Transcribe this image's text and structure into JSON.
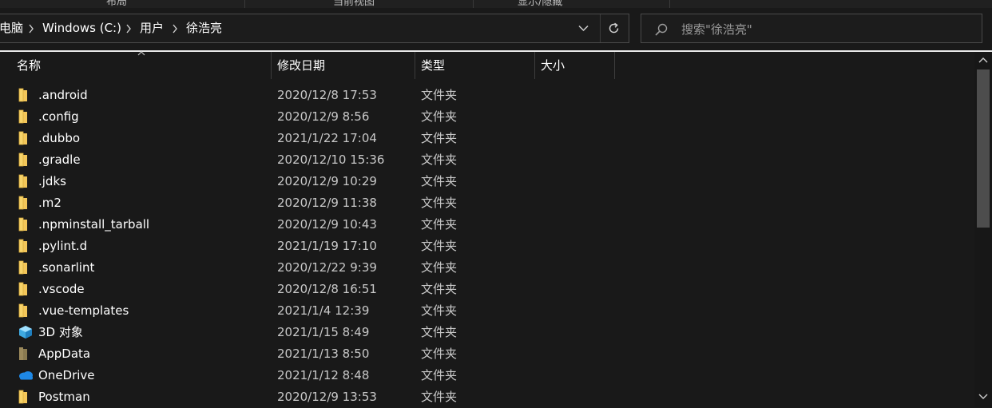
{
  "ribbon": {
    "groups": [
      "布局",
      "当前视图",
      "显示/隐藏"
    ]
  },
  "address": {
    "breadcrumbs": [
      "电脑",
      "Windows (C:)",
      "用户",
      "徐浩亮"
    ]
  },
  "search": {
    "placeholder": "搜索\"徐浩亮\""
  },
  "columns": {
    "name": "名称",
    "modified": "修改日期",
    "type": "类型",
    "size": "大小"
  },
  "files": [
    {
      "name": ".android",
      "modified": "2020/12/8 17:53",
      "type": "文件夹",
      "icon": "folder-icon"
    },
    {
      "name": ".config",
      "modified": "2020/12/9 8:56",
      "type": "文件夹",
      "icon": "folder-icon"
    },
    {
      "name": ".dubbo",
      "modified": "2021/1/22 17:04",
      "type": "文件夹",
      "icon": "folder-icon"
    },
    {
      "name": ".gradle",
      "modified": "2020/12/10 15:36",
      "type": "文件夹",
      "icon": "folder-icon"
    },
    {
      "name": ".jdks",
      "modified": "2020/12/9 10:29",
      "type": "文件夹",
      "icon": "folder-icon"
    },
    {
      "name": ".m2",
      "modified": "2020/12/9 11:38",
      "type": "文件夹",
      "icon": "folder-icon"
    },
    {
      "name": ".npminstall_tarball",
      "modified": "2020/12/9 10:43",
      "type": "文件夹",
      "icon": "folder-icon"
    },
    {
      "name": ".pylint.d",
      "modified": "2021/1/19 17:10",
      "type": "文件夹",
      "icon": "folder-icon"
    },
    {
      "name": ".sonarlint",
      "modified": "2020/12/22 9:39",
      "type": "文件夹",
      "icon": "folder-icon"
    },
    {
      "name": ".vscode",
      "modified": "2020/12/8 16:51",
      "type": "文件夹",
      "icon": "folder-icon"
    },
    {
      "name": ".vue-templates",
      "modified": "2021/1/4 12:39",
      "type": "文件夹",
      "icon": "folder-icon"
    },
    {
      "name": "3D 对象",
      "modified": "2021/1/15 8:49",
      "type": "文件夹",
      "icon": "3d-objects-icon"
    },
    {
      "name": "AppData",
      "modified": "2021/1/13 8:50",
      "type": "文件夹",
      "icon": "hidden-folder-icon"
    },
    {
      "name": "OneDrive",
      "modified": "2021/1/12 8:48",
      "type": "文件夹",
      "icon": "onedrive-cloud-icon"
    },
    {
      "name": "Postman",
      "modified": "2020/12/9 13:53",
      "type": "文件夹",
      "icon": "folder-icon"
    }
  ],
  "colors": {
    "background": "#191919",
    "folder": "#f7d46a",
    "onedrive": "#1e88e5"
  }
}
